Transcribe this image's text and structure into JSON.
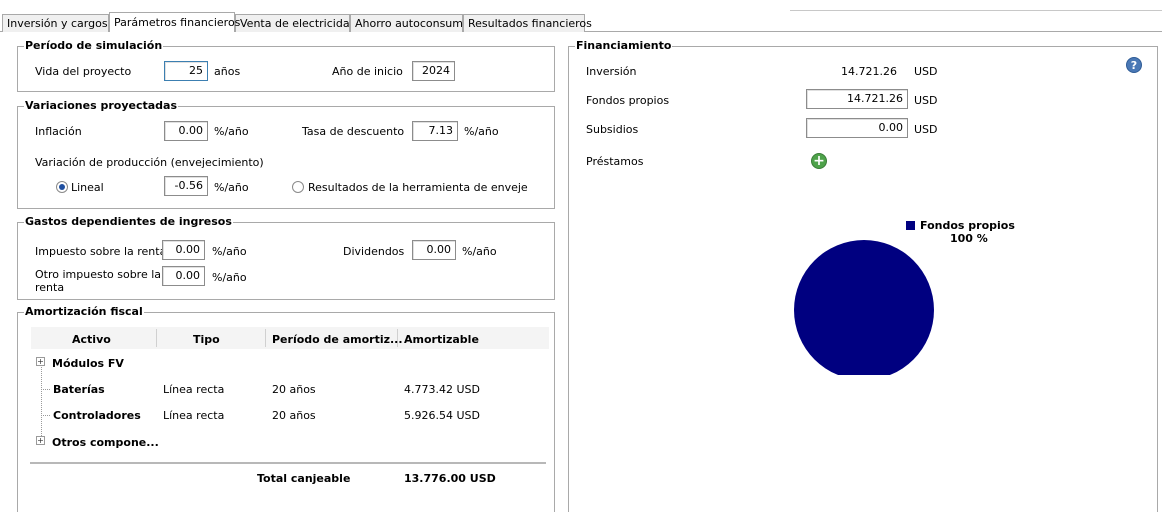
{
  "tabs": [
    "Inversión y cargos",
    "Parámetros financieros",
    "Venta de electricidad",
    "Ahorro autoconsumo",
    "Resultados financieros"
  ],
  "simulation": {
    "legend": "Período de simulación",
    "life_label": "Vida del proyecto",
    "life_value": "25",
    "life_unit": "años",
    "start_label": "Año de inicio",
    "start_value": "2024"
  },
  "variations": {
    "legend": "Variaciones proyectadas",
    "inflation_label": "Inflación",
    "inflation_value": "0.00",
    "pct_year": "%/año",
    "discount_label": "Tasa de descuento",
    "discount_value": "7.13",
    "production_label": "Variación de producción (envejecimiento)",
    "linear_label": "Lineal",
    "linear_value": "-0.56",
    "aging_tool_label": "Resultados de la herramienta de enveje"
  },
  "income_expenses": {
    "legend": "Gastos dependientes de ingresos",
    "income_tax_label": "Impuesto sobre la renta",
    "income_tax_value": "0.00",
    "dividends_label": "Dividendos",
    "dividends_value": "0.00",
    "other_tax_label_1": "Otro impuesto sobre la",
    "other_tax_label_2": "renta",
    "other_tax_value": "0.00",
    "pct_year": "%/año"
  },
  "amortization": {
    "legend": "Amortización fiscal",
    "columns": [
      "Activo",
      "Tipo",
      "Período de amortiz...",
      "Amortizable"
    ],
    "rows": [
      {
        "asset": "Módulos FV",
        "type": "",
        "period": "",
        "amount": ""
      },
      {
        "asset": "Baterías",
        "type": "Línea recta",
        "period": "20 años",
        "amount": "4.773.42 USD"
      },
      {
        "asset": "Controladores",
        "type": "Línea recta",
        "period": "20 años",
        "amount": "5.926.54 USD"
      },
      {
        "asset": "Otros compone...",
        "type": "",
        "period": "",
        "amount": ""
      }
    ],
    "total_label": "Total canjeable",
    "total_value": "13.776.00 USD"
  },
  "financing": {
    "legend": "Financiamiento",
    "investment_label": "Inversión",
    "investment_value": "14.721.26",
    "own_funds_label": "Fondos propios",
    "own_funds_value": "14.721.26",
    "subsidies_label": "Subsidios",
    "subsidies_value": "0.00",
    "loans_label": "Préstamos",
    "currency": "USD",
    "help_icon": "?",
    "add_icon": "+"
  },
  "chart_data": {
    "type": "pie",
    "categories": [
      "Fondos propios"
    ],
    "values": [
      100
    ],
    "labels": [
      "100 %"
    ],
    "colors": [
      "#000080"
    ],
    "legend": "top-right"
  }
}
